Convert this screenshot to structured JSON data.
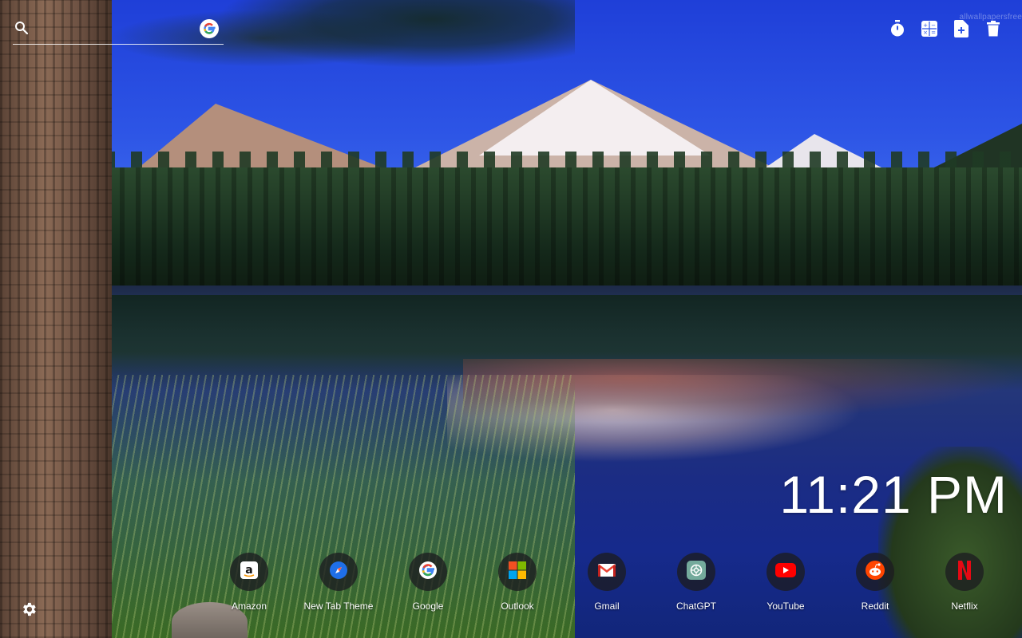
{
  "search": {
    "placeholder": "",
    "icon": "search-icon",
    "engine_icon": "google-icon"
  },
  "toolbar": {
    "buttons": [
      {
        "name": "timer-button",
        "icon": "stopwatch-icon"
      },
      {
        "name": "calculator-button",
        "icon": "calculator-icon"
      },
      {
        "name": "new-note-button",
        "icon": "add-document-icon"
      },
      {
        "name": "delete-button",
        "icon": "trash-icon"
      }
    ],
    "watermark": "allwallpapersfree"
  },
  "clock": {
    "time": "11:21 PM"
  },
  "shortcuts": [
    {
      "label": "Amazon",
      "icon": "amazon-icon"
    },
    {
      "label": "New Tab Theme",
      "icon": "compass-icon"
    },
    {
      "label": "Google",
      "icon": "google-icon"
    },
    {
      "label": "Outlook",
      "icon": "microsoft-icon"
    },
    {
      "label": "Gmail",
      "icon": "gmail-icon"
    },
    {
      "label": "ChatGPT",
      "icon": "chatgpt-icon"
    },
    {
      "label": "YouTube",
      "icon": "youtube-icon"
    },
    {
      "label": "Reddit",
      "icon": "reddit-icon"
    },
    {
      "label": "Netflix",
      "icon": "netflix-icon"
    }
  ],
  "settings": {
    "icon": "gear-icon"
  },
  "colors": {
    "sky": "#2d55e6",
    "shortcut_bg": "#1c1c20",
    "text": "#ffffff"
  }
}
